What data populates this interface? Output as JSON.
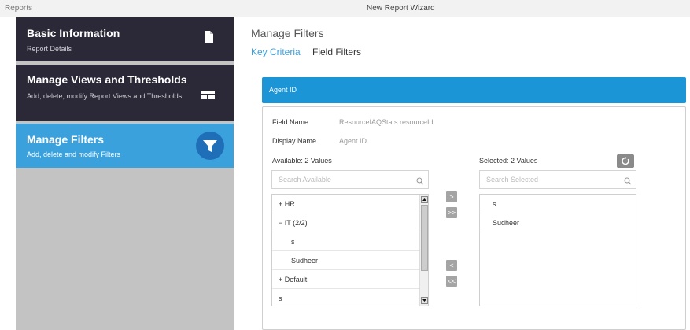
{
  "window": {
    "left_title": "Reports",
    "center_title": "New Report Wizard"
  },
  "sidebar": {
    "steps": [
      {
        "title": "Basic Information",
        "subtitle": "Report Details",
        "icon": "document-icon",
        "active": false
      },
      {
        "title": "Manage Views and Thresholds",
        "subtitle": "Add, delete, modify Report Views and Thresholds",
        "icon": "table-layout-icon",
        "active": false
      },
      {
        "title": "Manage Filters",
        "subtitle": "Add, delete and modify Filters",
        "icon": "filter-icon",
        "active": true
      }
    ]
  },
  "main": {
    "title": "Manage Filters",
    "tabs": [
      {
        "label": "Key Criteria",
        "active": true
      },
      {
        "label": "Field Filters",
        "active": false
      }
    ]
  },
  "filter": {
    "header": "Agent ID",
    "field_name_label": "Field Name",
    "field_name_value": "ResourceIAQStats.resourceId",
    "display_name_label": "Display Name",
    "display_name_value": "Agent ID",
    "available": {
      "label": "Available: 2 Values",
      "search_placeholder": "Search Available",
      "items": [
        {
          "text": "+ HR",
          "indent": 0
        },
        {
          "text": "− IT (2/2)",
          "indent": 0
        },
        {
          "text": "s",
          "indent": 1
        },
        {
          "text": "Sudheer",
          "indent": 1
        },
        {
          "text": "+ Default",
          "indent": 0
        },
        {
          "text": "s",
          "indent": 1
        }
      ]
    },
    "selected": {
      "label": "Selected: 2 Values",
      "search_placeholder": "Search Selected",
      "items": [
        "s",
        "Sudheer"
      ]
    },
    "buttons": {
      "move_right": ">",
      "move_all_right": ">>",
      "move_left": "<",
      "move_all_left": "<<"
    }
  },
  "colors": {
    "sidebar_dark": "#2b2837",
    "sidebar_active": "#3aa1dd",
    "sidebar_empty": "#c3c3c3",
    "agent_bar": "#1b95d6",
    "accent_link": "#3aa1dd"
  }
}
